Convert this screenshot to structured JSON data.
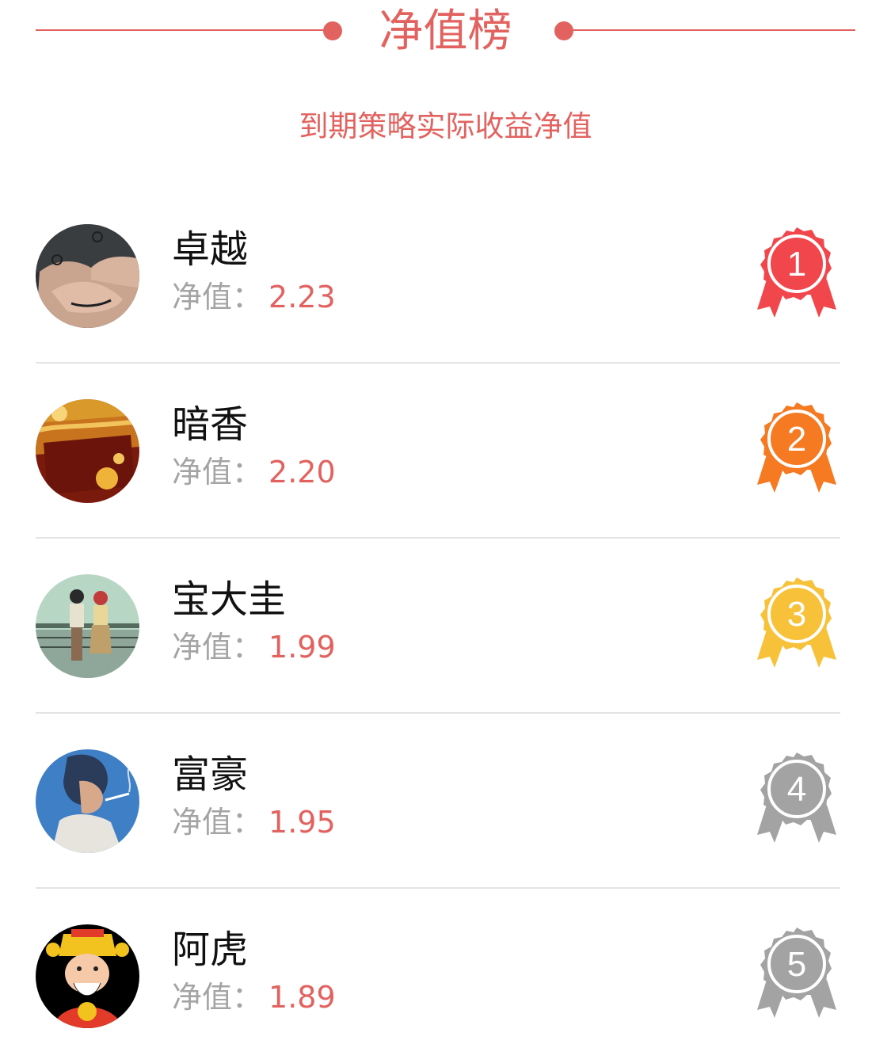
{
  "header": {
    "title": "净值榜",
    "subtitle": "到期策略实际收益净值",
    "accent_color": "#e2625f"
  },
  "ranking": {
    "value_label": "净值：",
    "items": [
      {
        "rank": "1",
        "name": "卓越",
        "value": "2.23",
        "badge_color": "#f1474c",
        "avatar": "holding-hands-photo"
      },
      {
        "rank": "2",
        "name": "暗香",
        "value": "2.20",
        "badge_color": "#f57a22",
        "avatar": "jewelry-box-photo"
      },
      {
        "rank": "3",
        "name": "宝大圭",
        "value": "1.99",
        "badge_color": "#f7c23a",
        "avatar": "anime-couple-picture"
      },
      {
        "rank": "4",
        "name": "富豪",
        "value": "1.95",
        "badge_color": "#a3a3a3",
        "avatar": "smoking-man-illustration"
      },
      {
        "rank": "5",
        "name": "阿虎",
        "value": "1.89",
        "badge_color": "#a3a3a3",
        "avatar": "god-of-wealth-cartoon"
      }
    ]
  }
}
